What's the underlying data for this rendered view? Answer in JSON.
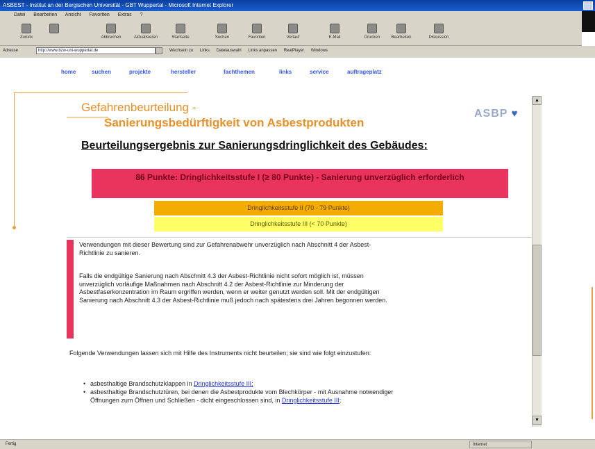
{
  "window": {
    "title": "ASBEST - Institut an der Bergischen Universität - GBT Wuppertal - Microsoft Internet Explorer"
  },
  "menubar": [
    "Datei",
    "Bearbeiten",
    "Ansicht",
    "Favoriten",
    "Extras",
    "?"
  ],
  "toolbar": [
    {
      "label": "Zurück",
      "icon": "back-icon"
    },
    {
      "label": "",
      "icon": "forward-icon"
    },
    {
      "label": "Abbrechen",
      "icon": "stop-icon"
    },
    {
      "label": "Aktualisieren",
      "icon": "refresh-icon"
    },
    {
      "label": "Startseite",
      "icon": "home-icon"
    },
    {
      "label": "Suchen",
      "icon": "search-icon"
    },
    {
      "label": "Favoriten",
      "icon": "favorites-icon"
    },
    {
      "label": "Verlauf",
      "icon": "history-icon"
    },
    {
      "label": "E-Mail",
      "icon": "mail-icon"
    },
    {
      "label": "Drucken",
      "icon": "print-icon"
    },
    {
      "label": "Bearbeiten",
      "icon": "edit-icon"
    },
    {
      "label": "Diskussion",
      "icon": "discuss-icon"
    }
  ],
  "address": {
    "label": "Adresse",
    "value": "http://www.bzw-uni-wuppertal.de",
    "links": [
      "Wechseln zu",
      "Links",
      "Dateiauswahl",
      "Links anpassen",
      "RealPlayer",
      "Windows"
    ]
  },
  "nav": [
    "home",
    "suchen",
    "projekte",
    "hersteller",
    "fachthemen",
    "links",
    "service",
    "auftrageplatz"
  ],
  "heading": {
    "line1": "Gefahrenbeurteilung -",
    "line2": "Sanierungsbedürftigkeit von Asbestprodukten"
  },
  "logo": "ASBP",
  "result": {
    "title": "Beurteilungsergebnis zur Sanierungsdringlichkeit des Gebäudes:",
    "level1_points": "86",
    "level1_text": "Punkte: Dringlichkeitsstufe I (≥ 80 Punkte) - Sanierung unverzüglich erforderlich",
    "level2": "Dringlichkeitsstufe II (70 - 79 Punkte)",
    "level3": "Dringlichkeitsstufe III (< 70 Punkte)"
  },
  "body": {
    "para1": "Verwendungen mit dieser Bewertung sind zur Gefahrenabwehr unverzüglich nach Abschnitt 4 der Asbest-Richtlinie zu sanieren.",
    "para2": "Falls die endgültige Sanierung nach Abschnitt 4.3 der Asbest-Richtlinie nicht sofort möglich ist, müssen unverzüglich vorläufige Maßnahmen nach Abschnitt 4.2 der Asbest-Richtlinie zur Minderung der Asbestfaserkonzentration im Raum ergriffen werden, wenn er weiter genutzt werden soll. Mit der endgültigen Sanierung nach Abschnitt 4.3 der Asbest-Richtlinie muß jedoch nach spätestens drei Jahren begonnen werden.",
    "para3": "Folgende Verwendungen lassen sich mit Hilfe des Instruments nicht beurteilen; sie sind wie folgt einzustufen:",
    "bullets": [
      {
        "text": "asbesthaltige Brandschutzklappen in ",
        "link": "Dringlichkeitsstufe III;"
      },
      {
        "text": "asbesthaltige Brandschutztüren, bei denen die Asbestprodukte vom Blechkörper - mit Ausnahme notwendiger Öffnungen zum Öffnen und Schließen - dicht eingeschlossen sind, in ",
        "link": "Dringlichkeitsstufe III;"
      }
    ]
  },
  "status": {
    "left": "Fertig",
    "zone": "Internet"
  }
}
